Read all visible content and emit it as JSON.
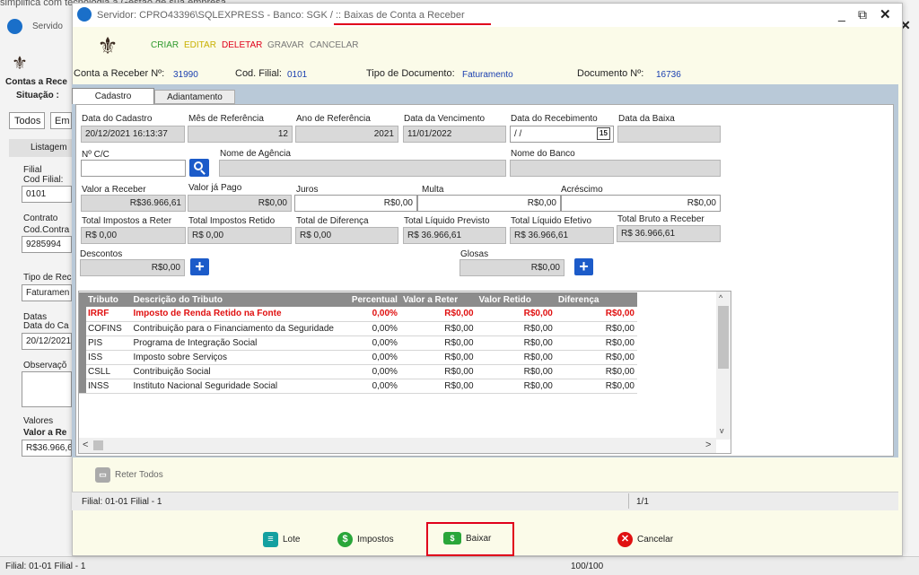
{
  "bg": {
    "top_text": "simplifica com tecnologia a Gestão de sua empresa",
    "servido": "Servido",
    "contas_a_rece": "Contas a Rece",
    "situacao": "Situação :",
    "tabs": [
      "Todos",
      "Em"
    ],
    "listagem": "Listagem",
    "filial": "Filial",
    "cod_filial": "Cod Filial:",
    "cod_filial_val": "0101",
    "contrato": "Contrato",
    "cod_contra": "Cod.Contra",
    "cod_contra_val": "9285994",
    "tipo_de_rec": "Tipo de Rec",
    "tipo_val": "Faturamen",
    "datas": "Datas",
    "data_do_ca": "Data do Ca",
    "data_val": "20/12/2021",
    "observacao": "Observaçõ",
    "valores": "Valores",
    "valor_a_re": "Valor a Re",
    "valor_val": "R$36.966,6",
    "close": "✕",
    "status_filial": "Filial: 01-01 Filial - 1",
    "status_count": "100/100"
  },
  "window": {
    "title_prefix": "Servidor: CPRO43396\\SQLEXPRESS - Banco: SGK /",
    "title_module": " :: Baixas de Conta a Receber",
    "minimize": "_",
    "popout": "⧉",
    "close": "✕"
  },
  "toolbar": {
    "criar": "CRIAR",
    "editar": "EDITAR",
    "deletar": "DELETAR",
    "gravar": "GRAVAR",
    "cancelar": "CANCELAR"
  },
  "header": {
    "conta_label": "Conta a Receber Nº:",
    "conta_val": "31990",
    "filial_label": "Cod. Filial:",
    "filial_val": "0101",
    "tipo_label": "Tipo de Documento:",
    "tipo_val": "Faturamento",
    "doc_label": "Documento Nº:",
    "doc_val": "16736"
  },
  "tabs": [
    "Cadastro",
    "Adiantamento"
  ],
  "form": {
    "data_cadastro_label": "Data do Cadastro",
    "data_cadastro": "20/12/2021 16:13:37",
    "mes_ref_label": "Mês de Referência",
    "mes_ref": "12",
    "ano_ref_label": "Ano de Referência",
    "ano_ref": "2021",
    "data_venc_label": "Data da Vencimento",
    "data_venc": "11/01/2022",
    "data_receb_label": "Data do Recebimento",
    "data_receb": " / /",
    "cal_icon": "15",
    "data_baixa_label": "Data da Baixa",
    "data_baixa": "",
    "ncc_label": "Nº C/C",
    "ncc": "",
    "agencia_label": "Nome de Agência",
    "agencia": "",
    "banco_label": "Nome do Banco",
    "banco": "",
    "valor_receber_label": "Valor a Receber",
    "valor_receber": "R$36.966,61",
    "valor_pago_label": "Valor já Pago",
    "valor_pago": "R$0,00",
    "juros_label": "Juros",
    "juros": "R$0,00",
    "multa_label": "Multa",
    "multa": "R$0,00",
    "acrescimo_label": "Acréscimo",
    "acrescimo": "R$0,00",
    "tot_imp_reter_label": "Total Impostos a Reter",
    "tot_imp_reter": "R$ 0,00",
    "tot_imp_retido_label": "Total Impostos Retido",
    "tot_imp_retido": "R$ 0,00",
    "tot_diferenca_label": "Total de Diferença",
    "tot_diferenca": "R$ 0,00",
    "tot_liq_prev_label": "Total Líquido Previsto",
    "tot_liq_prev": "R$ 36.966,61",
    "tot_liq_efet_label": "Total Líquido Efetivo",
    "tot_liq_efet": "R$ 36.966,61",
    "tot_bruto_label": "Total Bruto a Receber",
    "tot_bruto": "R$ 36.966,61",
    "descontos_label": "Descontos",
    "descontos": "R$0,00",
    "glosas_label": "Glosas",
    "glosas": "R$0,00",
    "plus": "+"
  },
  "grid": {
    "columns": [
      "Tributo",
      "Descrição do Tributo",
      "Percentual",
      "Valor a Reter",
      "Valor Retido",
      "Diferença"
    ],
    "rows": [
      [
        "IRRF",
        "Imposto de Renda Retido na Fonte",
        "0,00%",
        "R$0,00",
        "R$0,00",
        "R$0,00"
      ],
      [
        "COFINS",
        "Contribuição para o Financiamento da Seguridade",
        "0,00%",
        "R$0,00",
        "R$0,00",
        "R$0,00"
      ],
      [
        "PIS",
        "Programa de Integração Social",
        "0,00%",
        "R$0,00",
        "R$0,00",
        "R$0,00"
      ],
      [
        "ISS",
        "Imposto sobre Serviços",
        "0,00%",
        "R$0,00",
        "R$0,00",
        "R$0,00"
      ],
      [
        "CSLL",
        "Contribuição Social",
        "0,00%",
        "R$0,00",
        "R$0,00",
        "R$0,00"
      ],
      [
        "INSS",
        "Instituto Nacional Seguridade Social",
        "0,00%",
        "R$0,00",
        "R$0,00",
        "R$0,00"
      ]
    ],
    "scroll_up": "^",
    "scroll_down": "v",
    "scroll_left": "<",
    "scroll_right": ">"
  },
  "reter_todos": "Reter Todos",
  "status": {
    "filial": "Filial: 01-01 Filial - 1",
    "page": "1/1"
  },
  "actions": {
    "lote": "Lote",
    "impostos": "Impostos",
    "baixar": "Baixar",
    "cancelar": "Cancelar"
  },
  "colors": {
    "accent_red": "#e0001b",
    "title_blue": "#1a6fc9",
    "row_red": "#e01010"
  }
}
